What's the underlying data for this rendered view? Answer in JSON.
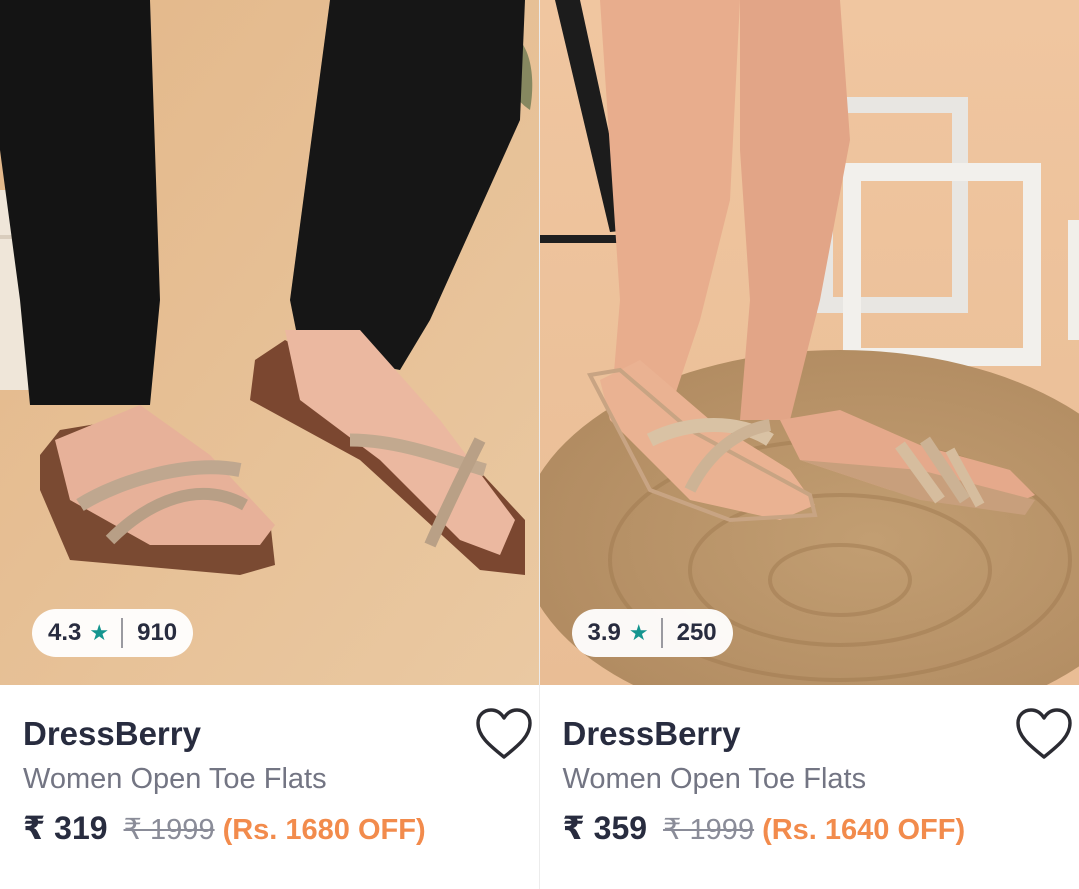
{
  "products": [
    {
      "brand": "DressBerry",
      "title": "Women Open Toe Flats",
      "price": "₹ 319",
      "mrp": "₹ 1999",
      "discount": "(Rs. 1680 OFF)",
      "rating": "4.3",
      "rating_count": "910",
      "rating_star_icon": "star-icon",
      "wishlist_icon": "heart-icon"
    },
    {
      "brand": "DressBerry",
      "title": "Women Open Toe Flats",
      "price": "₹ 359",
      "mrp": "₹ 1999",
      "discount": "(Rs. 1640 OFF)",
      "rating": "3.9",
      "rating_count": "250",
      "rating_star_icon": "star-icon",
      "wishlist_icon": "heart-icon"
    }
  ],
  "colors": {
    "star": "#14958f",
    "discount": "#f28b4c",
    "text_primary": "#282c3f",
    "text_secondary": "#737583"
  }
}
